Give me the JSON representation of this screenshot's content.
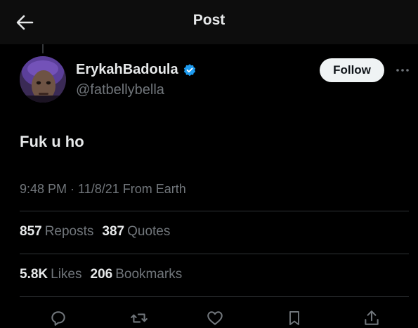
{
  "header": {
    "title": "Post",
    "back_icon": "arrow-left-icon"
  },
  "author": {
    "display_name": "ErykahBadoula",
    "handle": "@fatbellybella",
    "verified": true,
    "verified_color": "#1d9bf0"
  },
  "follow": {
    "label": "Follow"
  },
  "more": {
    "icon": "more-horizontal-icon"
  },
  "post": {
    "text": "Fuk u ho",
    "meta": "9:48 PM · 11/8/21 From Earth"
  },
  "stats": {
    "reposts": {
      "count": "857",
      "label": "Reposts"
    },
    "quotes": {
      "count": "387",
      "label": "Quotes"
    },
    "likes": {
      "count": "5.8K",
      "label": "Likes"
    },
    "bookmarks": {
      "count": "206",
      "label": "Bookmarks"
    }
  },
  "actions": [
    "reply-icon",
    "repost-icon",
    "like-icon",
    "bookmark-icon",
    "share-icon"
  ],
  "colors": {
    "background": "#000000",
    "text_primary": "#e7e9ea",
    "text_secondary": "#71767b",
    "divider": "#2f3336",
    "follow_bg": "#eff3f4"
  }
}
